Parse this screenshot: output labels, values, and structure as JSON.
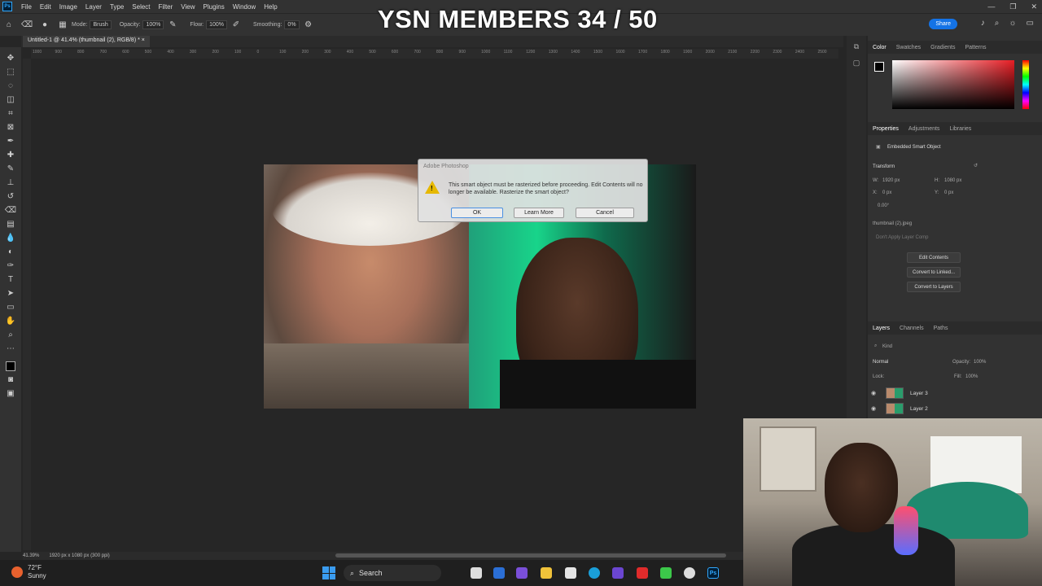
{
  "menu": {
    "app_logo": "Ps",
    "items": [
      "File",
      "Edit",
      "Image",
      "Layer",
      "Type",
      "Select",
      "Filter",
      "View",
      "Plugins",
      "Window",
      "Help"
    ],
    "window_controls": [
      "—",
      "❐",
      "✕"
    ]
  },
  "options_bar": {
    "mode_label": "Mode:",
    "mode_value": "Brush",
    "opacity_label": "Opacity:",
    "opacity_value": "100%",
    "flow_label": "Flow:",
    "flow_value": "100%",
    "smoothing_label": "Smoothing:",
    "smoothing_value": "0%",
    "share_label": "Share"
  },
  "overlay": {
    "title": "YSN MEMBERS 34 / 50"
  },
  "document": {
    "tab_title": "Untitled-1 @ 41.4% (thumbnail (2), RGB/8) *"
  },
  "ruler": {
    "ticks": [
      "1000",
      "900",
      "800",
      "700",
      "600",
      "500",
      "400",
      "300",
      "200",
      "100",
      "0",
      "100",
      "200",
      "300",
      "400",
      "500",
      "600",
      "700",
      "800",
      "900",
      "1000",
      "1100",
      "1200",
      "1300",
      "1400",
      "1500",
      "1600",
      "1700",
      "1800",
      "1900",
      "2000",
      "2100",
      "2200",
      "2300",
      "2400",
      "2500"
    ]
  },
  "dialog": {
    "title": "Adobe Photoshop",
    "message": "This smart object must be rasterized before proceeding. Edit Contents will no longer be available. Rasterize the smart object?",
    "ok_label": "OK",
    "learn_more_label": "Learn More",
    "cancel_label": "Cancel"
  },
  "status": {
    "zoom": "41.39%",
    "doc_info": "1920 px x 1080 px (300 ppi)"
  },
  "color_panel": {
    "tabs": [
      "Color",
      "Swatches",
      "Gradients",
      "Patterns"
    ],
    "accent": "#e81e25"
  },
  "properties_panel": {
    "tabs": [
      "Properties",
      "Adjustments",
      "Libraries"
    ],
    "object_type": "Embedded Smart Object",
    "transform_label": "Transform",
    "w_label": "W:",
    "w_value": "1920 px",
    "h_label": "H:",
    "h_value": "1080 px",
    "x_label": "X:",
    "x_value": "0 px",
    "y_label": "Y:",
    "y_value": "0 px",
    "angle_value": "0.00°",
    "source_file": "thumbnail (2).jpeg",
    "layer_comp": "Don't Apply Layer Comp",
    "buttons": [
      "Edit Contents",
      "Convert to Linked...",
      "Convert to Layers"
    ]
  },
  "layers_panel": {
    "tabs": [
      "Layers",
      "Channels",
      "Paths"
    ],
    "filter_label": "Kind",
    "blend_mode": "Normal",
    "opacity_label": "Opacity:",
    "opacity_value": "100%",
    "lock_label": "Lock:",
    "fill_label": "Fill:",
    "fill_value": "100%",
    "layers": [
      "Layer 3",
      "Layer 2"
    ]
  },
  "taskbar": {
    "weather_temp": "72°F",
    "weather_desc": "Sunny",
    "search_placeholder": "Search"
  }
}
